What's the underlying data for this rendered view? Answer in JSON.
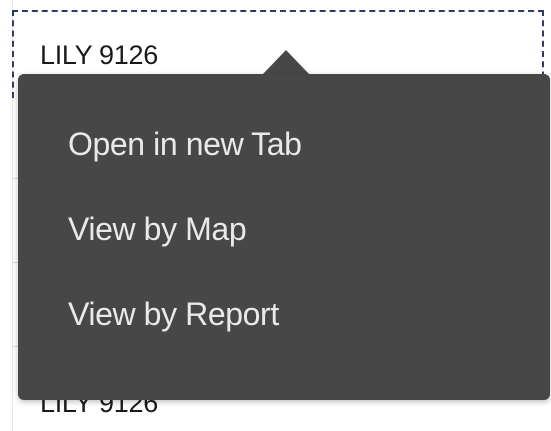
{
  "list": {
    "selected_item_label": "LILY 9126",
    "partially_hidden_item_label": "LILY 9126"
  },
  "context_menu": {
    "items": [
      {
        "label": "Open in new Tab"
      },
      {
        "label": "View by Map"
      },
      {
        "label": "View by Report"
      }
    ]
  },
  "colors": {
    "menu_background": "#474747",
    "menu_text": "#e9e9e9",
    "selection_outline": "#2f3b66",
    "item_text": "#1a1a1a"
  }
}
